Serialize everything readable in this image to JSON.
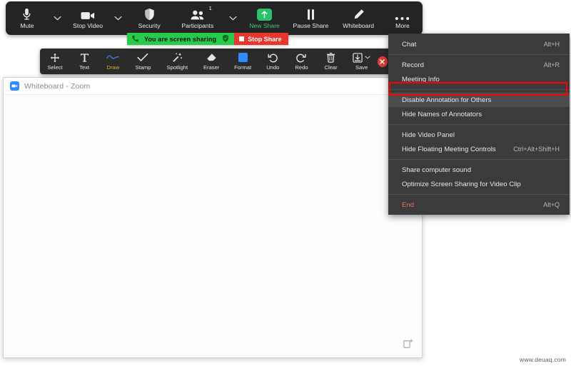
{
  "meeting_toolbar": {
    "items": [
      {
        "label": "Mute",
        "icon": "microphone-icon",
        "caret": true
      },
      {
        "label": "Stop Video",
        "icon": "video-camera-icon",
        "caret": true
      },
      {
        "label": "Security",
        "icon": "shield-icon",
        "caret": false
      },
      {
        "label": "Participants",
        "icon": "participants-icon",
        "caret": true,
        "badge": "1"
      },
      {
        "label": "New Share",
        "icon": "upload-arrow-icon",
        "caret": false,
        "accent": true
      },
      {
        "label": "Pause Share",
        "icon": "pause-icon",
        "caret": false
      },
      {
        "label": "Whiteboard",
        "icon": "pencil-icon",
        "caret": false
      },
      {
        "label": "More",
        "icon": "ellipsis-icon",
        "caret": false
      }
    ]
  },
  "sharing_strip": {
    "status_text": "You are screen sharing",
    "stop_label": "Stop Share",
    "phone_icon": "phone-icon",
    "shield_icon": "shield-icon",
    "green": "#27CB49",
    "red": "#E8352E"
  },
  "annotation_toolbar": {
    "items": [
      {
        "label": "Select",
        "icon": "move-arrows-icon",
        "active": false
      },
      {
        "label": "Text",
        "icon": "text-t-icon",
        "active": false
      },
      {
        "label": "Draw",
        "icon": "squiggle-icon",
        "active": true
      },
      {
        "label": "Stamp",
        "icon": "checkmark-icon",
        "active": false
      },
      {
        "label": "Spotlight",
        "icon": "spotlight-wand-icon",
        "active": false
      },
      {
        "label": "Eraser",
        "icon": "eraser-icon",
        "active": false
      },
      {
        "label": "Format",
        "icon": "color-swatch-icon",
        "active": false
      },
      {
        "label": "Undo",
        "icon": "undo-arrow-icon",
        "active": false
      },
      {
        "label": "Redo",
        "icon": "redo-arrow-icon",
        "active": false
      },
      {
        "label": "Clear",
        "icon": "trash-icon",
        "active": false
      },
      {
        "label": "Save",
        "icon": "save-download-icon",
        "active": false,
        "caret": true
      }
    ],
    "close_icon": "close-x-icon",
    "active_color": "#E8A526"
  },
  "whiteboard_window": {
    "title": "Whiteboard - Zoom",
    "app_icon": "zoom-camera-icon",
    "new_page_icon": "add-page-icon"
  },
  "more_menu": {
    "groups": [
      [
        {
          "label": "Chat",
          "shortcut": "Alt+H"
        }
      ],
      [
        {
          "label": "Record",
          "shortcut": "Alt+R"
        },
        {
          "label": "Meeting Info",
          "shortcut": ""
        }
      ],
      [
        {
          "label": "Disable Annotation for Others",
          "shortcut": "",
          "highlighted": true
        },
        {
          "label": "Hide Names of Annotators",
          "shortcut": ""
        }
      ],
      [
        {
          "label": "Hide Video Panel",
          "shortcut": ""
        },
        {
          "label": "Hide Floating Meeting Controls",
          "shortcut": "Ctrl+Alt+Shift+H"
        }
      ],
      [
        {
          "label": "Share computer sound",
          "shortcut": ""
        },
        {
          "label": "Optimize Screen Sharing for Video Clip",
          "shortcut": ""
        }
      ],
      [
        {
          "label": "End",
          "shortcut": "Alt+Q",
          "danger": true
        }
      ]
    ],
    "highlight_color": "#FF0000"
  },
  "watermark": {
    "text": "www.deuaq.com"
  }
}
